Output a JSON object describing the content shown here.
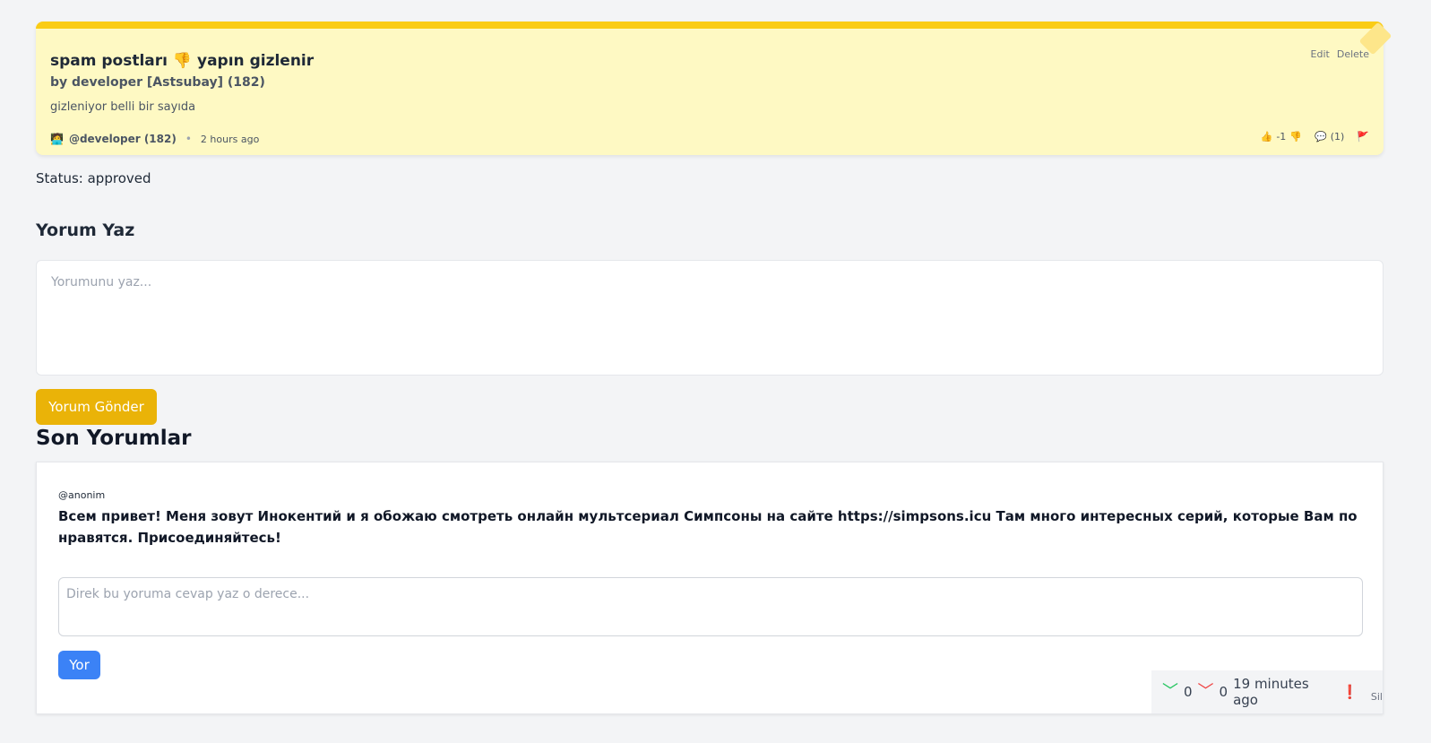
{
  "post": {
    "title": "spam postları 👎 yapın gizlenir",
    "author": "by developer [Astsubay] (182)",
    "body": "gizleniyor belli bir sayıda",
    "user_emoji": "🧑‍💻",
    "user_handle": "@developer (182)",
    "time": "2 hours ago",
    "edit_label": "Edit",
    "delete_label": "Delete",
    "like_emoji": "👍",
    "score": "-1",
    "dislike_emoji": "👎",
    "comment_emoji": "💬",
    "comment_count": "(1)",
    "flag_icon": "🚩"
  },
  "status": "Status: approved",
  "comment_form": {
    "heading": "Yorum Yaz",
    "placeholder": "Yorumunu yaz...",
    "submit_label": "Yorum Gönder"
  },
  "recent": {
    "heading": "Son Yorumlar",
    "comments": [
      {
        "user": "@anonim",
        "text": "Всем привет! Меня зовут Инокентий и я обожаю смотреть онлайн мультсериал Симпсоны на сайте https://simpsons.icu Там много интересных серий, которые Вам понравятся. Присоединяйтесь!",
        "reply_placeholder": "Direk bu yoruma cevap yaz o derece...",
        "reply_label": "Yor",
        "upvotes": "0",
        "downvotes": "0",
        "time": "19 minutes ago",
        "report_icon": "❗",
        "delete_label": "Sil"
      }
    ]
  }
}
